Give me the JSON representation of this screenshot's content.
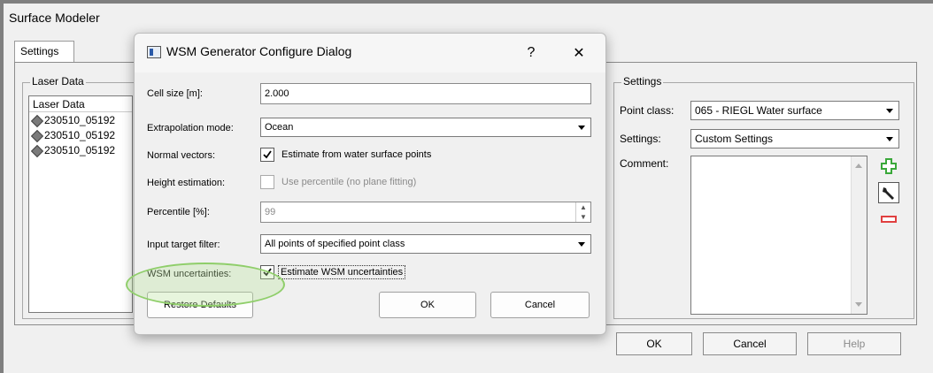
{
  "window": {
    "title": "Surface Modeler"
  },
  "tabs": [
    {
      "label": "Settings"
    }
  ],
  "laser_data": {
    "group_label": "Laser Data",
    "column_header": "Laser Data",
    "rows": [
      "230510_05192",
      "230510_05192",
      "230510_05192"
    ]
  },
  "right_settings": {
    "group_label": "Settings",
    "point_class_label": "Point class:",
    "point_class_value": "065 - RIEGL Water surface",
    "settings_label": "Settings:",
    "settings_value": "Custom Settings",
    "comment_label": "Comment:"
  },
  "bottom_buttons": {
    "ok": "OK",
    "cancel": "Cancel",
    "help": "Help"
  },
  "dialog": {
    "title": "WSM Generator Configure Dialog",
    "help_glyph": "?",
    "close_glyph": "✕",
    "cell_size": {
      "label": "Cell size [m]:",
      "value": "2.000"
    },
    "extrapolation_mode": {
      "label": "Extrapolation mode:",
      "value": "Ocean"
    },
    "normal_vectors": {
      "label": "Normal vectors:",
      "checkbox_label": "Estimate from water surface points",
      "checked": true
    },
    "height_estimation": {
      "label": "Height estimation:",
      "checkbox_label": "Use percentile (no plane fitting)",
      "checked": false
    },
    "percentile": {
      "label": "Percentile [%]:",
      "value": "99"
    },
    "input_target_filter": {
      "label": "Input target filter:",
      "value": "All points of specified point class"
    },
    "wsm_uncertainties": {
      "label": "WSM uncertainties:",
      "checkbox_label": "Estimate WSM uncertainties",
      "checked": true
    },
    "restore_defaults": "Restore Defaults",
    "ok": "OK",
    "cancel": "Cancel"
  },
  "colors": {
    "highlight_ellipse": "#8fce6a",
    "add_icon": "#3aa83a",
    "remove_icon": "#e04040"
  },
  "icons": [
    "add-icon",
    "wrench-icon",
    "remove-icon",
    "diamond-icon",
    "checkmark-icon"
  ]
}
